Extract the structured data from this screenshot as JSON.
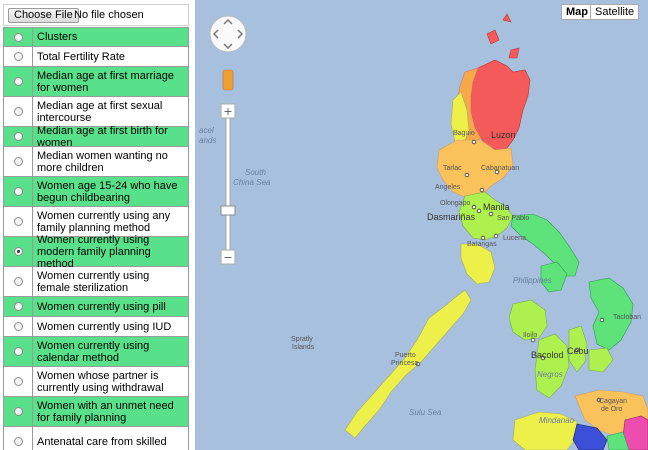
{
  "file_input": {
    "button_label": "Choose File",
    "status": "No file chosen"
  },
  "options": [
    {
      "label": "Clusters",
      "highlight": true,
      "selected": false,
      "tall": false
    },
    {
      "label": "Total Fertility Rate",
      "highlight": false,
      "selected": false,
      "tall": false
    },
    {
      "label": "Median age at first marriage for women",
      "highlight": true,
      "selected": false,
      "tall": true
    },
    {
      "label": "Median age at first sexual intercourse",
      "highlight": false,
      "selected": false,
      "tall": true
    },
    {
      "label": "Median age at first birth for women",
      "highlight": true,
      "selected": false,
      "tall": false
    },
    {
      "label": "Median women wanting no more children",
      "highlight": false,
      "selected": false,
      "tall": true
    },
    {
      "label": "Women age 15-24 who have begun childbearing",
      "highlight": true,
      "selected": false,
      "tall": true
    },
    {
      "label": "Women currently using any family planning method",
      "highlight": false,
      "selected": false,
      "tall": true
    },
    {
      "label": "Women currently using modern family planning method",
      "highlight": true,
      "selected": true,
      "tall": true
    },
    {
      "label": "Women currently using female sterilization",
      "highlight": false,
      "selected": false,
      "tall": true
    },
    {
      "label": "Women currently using pill",
      "highlight": true,
      "selected": false,
      "tall": false
    },
    {
      "label": "Women currently using IUD",
      "highlight": false,
      "selected": false,
      "tall": false
    },
    {
      "label": "Women currently using calendar method",
      "highlight": true,
      "selected": false,
      "tall": true
    },
    {
      "label": "Women whose partner is currently using withdrawal",
      "highlight": false,
      "selected": false,
      "tall": true
    },
    {
      "label": "Women with an unmet need for family planning",
      "highlight": true,
      "selected": false,
      "tall": true
    },
    {
      "label": "Antenatal care from skilled",
      "highlight": false,
      "selected": false,
      "tall": true
    }
  ],
  "map": {
    "type_buttons": {
      "map": "Map",
      "satellite": "Satellite"
    },
    "labels": {
      "paracel": "acel",
      "paracel2": "ands",
      "south_china_sea_1": "South",
      "south_china_sea_2": "China Sea",
      "luzon": "Luzon",
      "baguio": "Baguio",
      "tarlac": "Tarlac",
      "cabanatuan": "Cabanatuan",
      "angeles": "Angeles",
      "olongapo": "Olongapo",
      "manila": "Manila",
      "dasmarinas": "Dasmariñas",
      "san_pablo": "San Pablo",
      "lucena": "Lucena",
      "batangas": "Batangas",
      "philippines": "Philippines",
      "tacloban": "Tacloban",
      "spratly_1": "Spratly",
      "spratly_2": "Islands",
      "puerto_princesa_1": "Puerto",
      "puerto_princesa_2": "Princesa",
      "iloilo": "Iloilo",
      "bacolod": "Bacolod",
      "negros": "Negros",
      "cebu": "Cebu",
      "sulu_sea": "Sulu Sea",
      "cagayan_1": "Cagayan",
      "cagayan_2": "de Oro",
      "mindanao": "Mindanao"
    },
    "colors": {
      "water": "#a7c0de",
      "red": "#f45a5a",
      "orange": "#f7a94a",
      "light_orange": "#f9c25a",
      "yellow": "#eef04a",
      "light_green": "#aef04d",
      "green": "#5ee27a",
      "blue": "#3b4fd8",
      "pink": "#ee4db0"
    }
  }
}
